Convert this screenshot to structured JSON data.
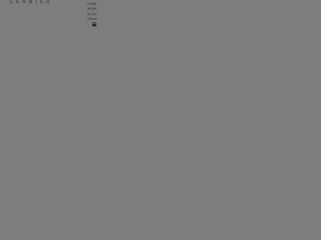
{
  "brand": {
    "logo_text": "CERNICA"
  },
  "nav": {
    "items": [
      {
        "label": "HOME"
      },
      {
        "label": "WORK"
      },
      {
        "label": "BLOG"
      },
      {
        "label": "PANEL"
      }
    ]
  },
  "controls": {
    "toggle_icon": "menu-toggle-icon"
  },
  "colors": {
    "background": "#7d7d7d",
    "text": "#1e1e1e",
    "button": "#2b2b2b"
  }
}
